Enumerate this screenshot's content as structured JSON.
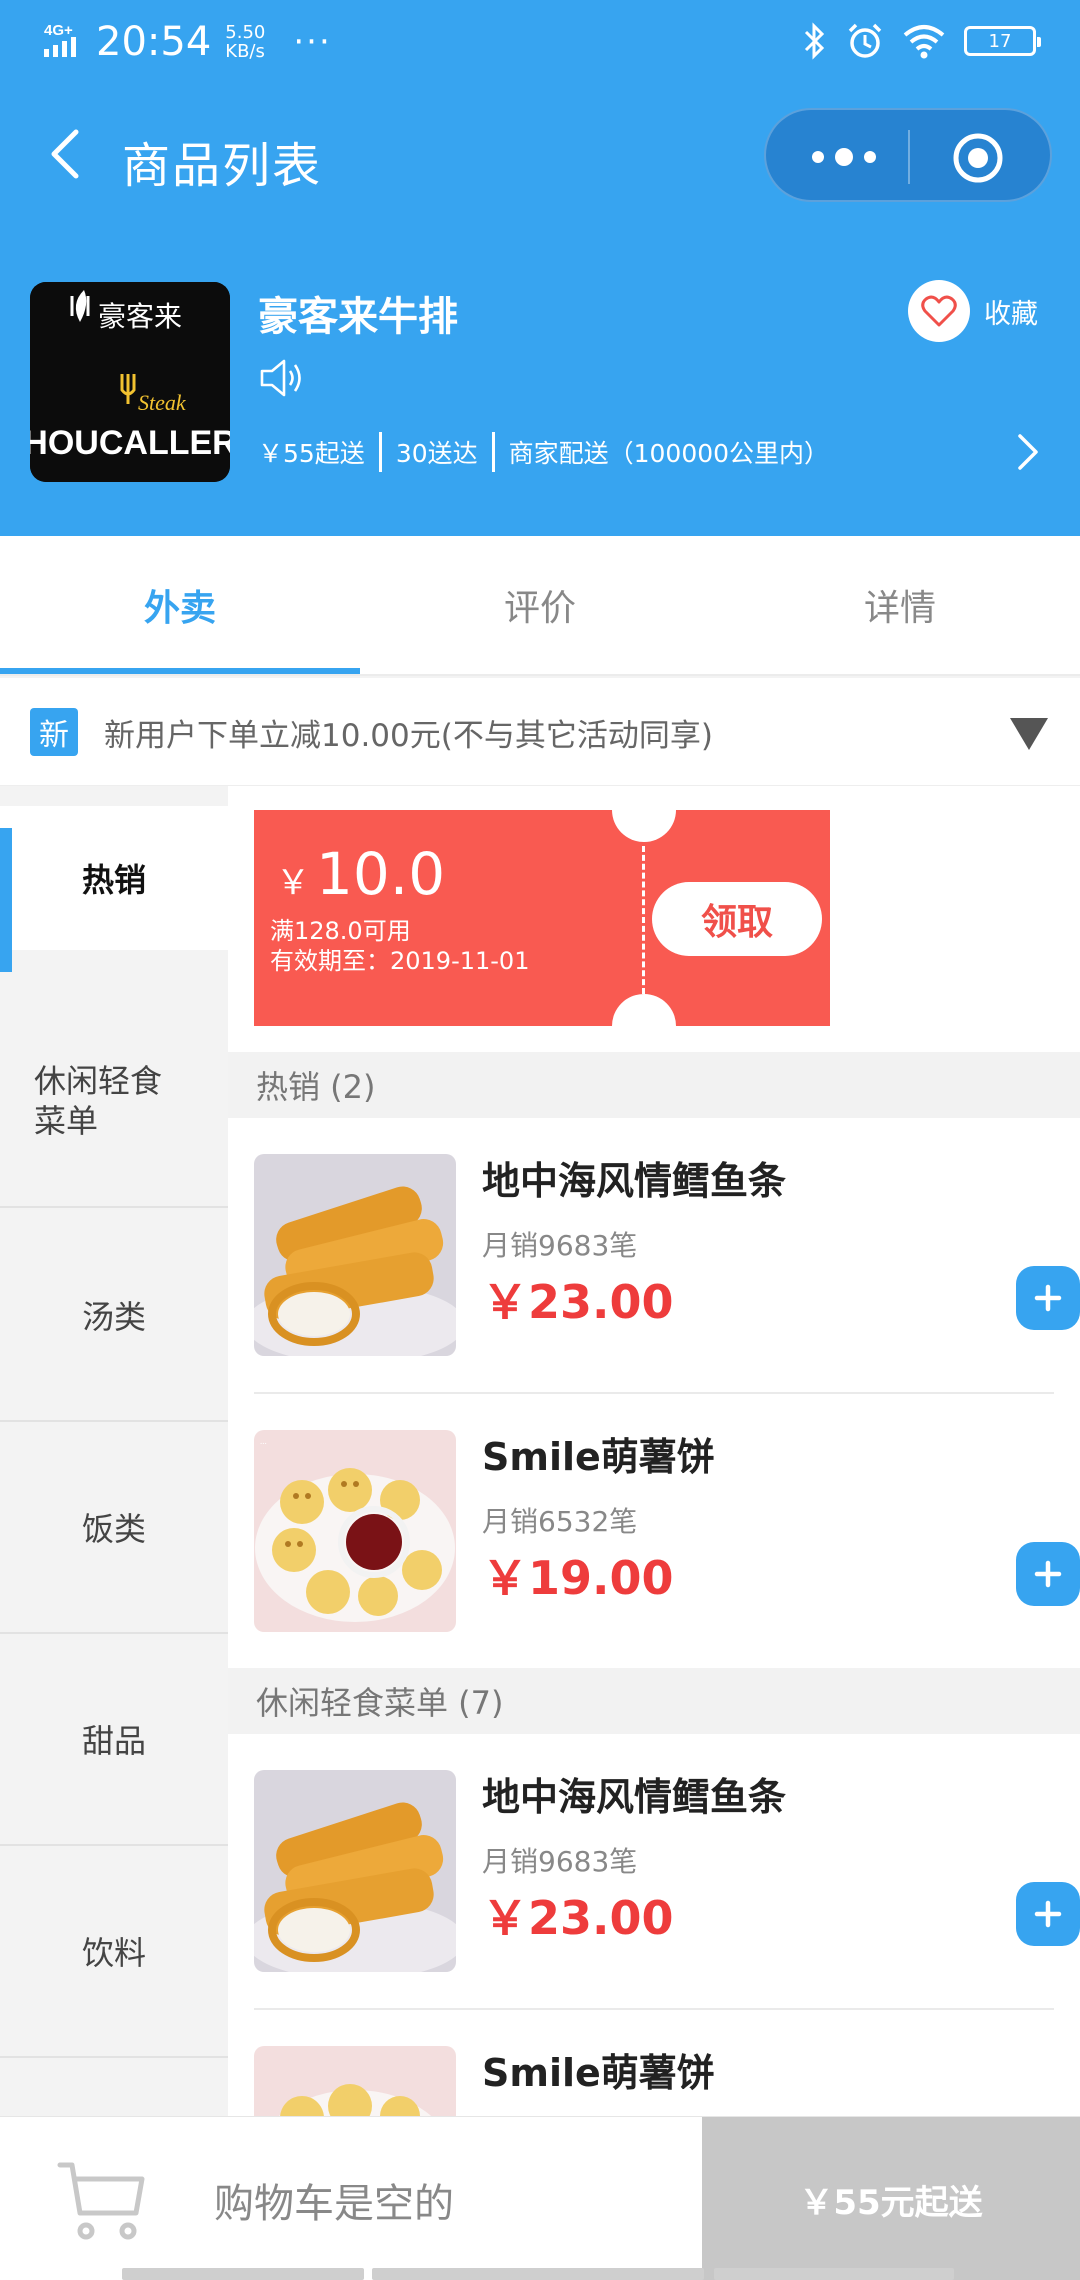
{
  "status_bar": {
    "network": "4G⁺",
    "time": "20:54",
    "speed_value": "5.50",
    "speed_unit": "KB/s",
    "dots": "···",
    "battery": "17"
  },
  "nav": {
    "title": "商品列表"
  },
  "store": {
    "name": "豪客来牛排",
    "logo_cn": "豪客来",
    "logo_steak": "Steak",
    "logo_en": "HOUCALLER",
    "min_order": "￥55起送",
    "delivery_fee": "30送达",
    "delivery_scope": "商家配送（100000公里内）",
    "favorite_label": "收藏"
  },
  "tabs": [
    {
      "label": "外卖",
      "active": true
    },
    {
      "label": "评价",
      "active": false
    },
    {
      "label": "详情",
      "active": false
    }
  ],
  "promo": {
    "badge": "新",
    "text": "新用户下单立减10.00元(不与其它活动同享)"
  },
  "categories": [
    {
      "label": "热销",
      "active": true
    },
    {
      "label": "休闲轻食菜单",
      "active": false
    },
    {
      "label": "汤类",
      "active": false
    },
    {
      "label": "饭类",
      "active": false
    },
    {
      "label": "甜品",
      "active": false
    },
    {
      "label": "饮料",
      "active": false
    }
  ],
  "coupon": {
    "currency": "￥",
    "amount": "10.0",
    "condition": "满128.0可用",
    "validity": "有效期至：2019-11-01",
    "button": "领取"
  },
  "sections": [
    {
      "title": "热销 (2)",
      "items": [
        {
          "name": "地中海风情鳕鱼条",
          "sales": "月销9683笔",
          "price": "￥23.00",
          "image": "fish-sticks"
        },
        {
          "name": "Smile萌薯饼",
          "sales": "月销6532笔",
          "price": "￥19.00",
          "image": "smile-potato"
        }
      ]
    },
    {
      "title": "休闲轻食菜单 (7)",
      "items": [
        {
          "name": "地中海风情鳕鱼条",
          "sales": "月销9683笔",
          "price": "￥23.00",
          "image": "fish-sticks"
        },
        {
          "name": "Smile萌薯饼",
          "sales": "",
          "price": "",
          "image": "smile-potato"
        }
      ]
    }
  ],
  "cart": {
    "empty_text": "购物车是空的",
    "min_button": "￥55元起送"
  },
  "colors": {
    "primary": "#37a4f0",
    "price": "#ee3c3c",
    "coupon": "#f95a51"
  }
}
